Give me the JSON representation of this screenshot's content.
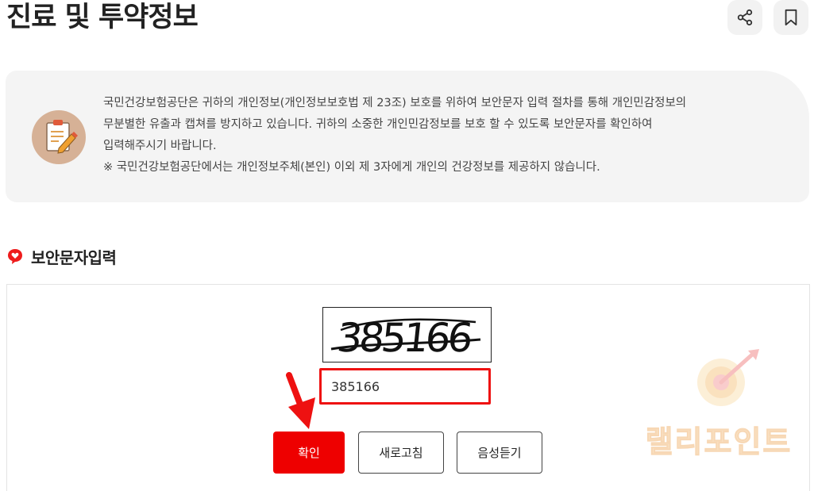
{
  "header": {
    "title": "진료 및 투약정보",
    "share_icon": "share-icon",
    "bookmark_icon": "bookmark-icon"
  },
  "notice": {
    "icon": "clipboard-pencil-icon",
    "lines": [
      "국민건강보험공단은 귀하의 개인정보(개인정보보호법 제 23조) 보호를 위하여 보안문자 입력 절차를 통해 개인민감정보의",
      "무분별한 유출과 캡쳐를 방지하고 있습니다. 귀하의 소중한 개인민감정보를 보호 할 수 있도록 보안문자를 확인하여",
      "입력해주시기 바랍니다.",
      "※ 국민건강보험공단에서는 개인정보주체(본인) 이외 제 3자에게 개인의 건강정보를 제공하지 않습니다."
    ]
  },
  "section": {
    "title": "보안문자입력",
    "icon": "heart-speech-bubble-icon"
  },
  "captcha": {
    "image_text": "385166",
    "input_value": "385166"
  },
  "buttons": {
    "confirm": "확인",
    "refresh": "새로고침",
    "audio": "음성듣기"
  },
  "annotation": {
    "arrow_color": "#ee1111",
    "highlight_color": "#ee1111"
  },
  "watermark": {
    "text": "랠리포인트",
    "icon": "target-arrow-icon"
  },
  "colors": {
    "accent": "#ee0000",
    "notice_bg": "#f4f4f4",
    "icon_circle": "#d6b196"
  }
}
